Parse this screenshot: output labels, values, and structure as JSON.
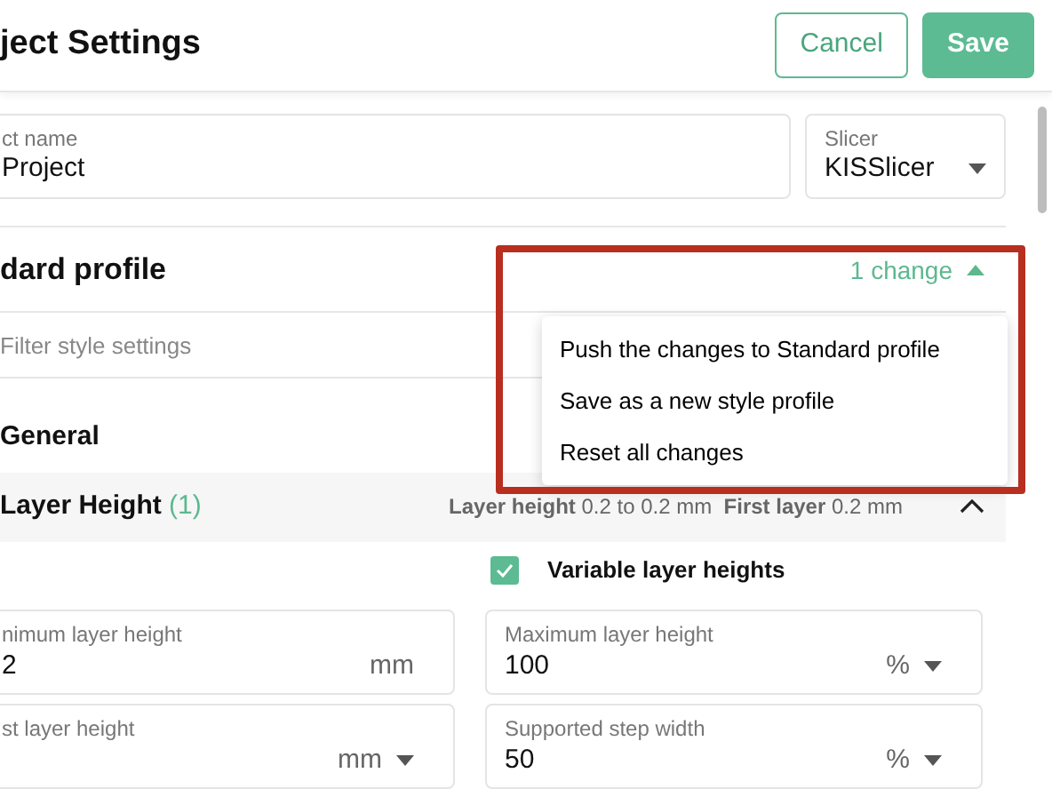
{
  "header": {
    "title": "ject Settings",
    "buttons": [
      {
        "label": "Cancel",
        "kind": "outline"
      },
      {
        "label": "Save",
        "kind": "primary"
      }
    ]
  },
  "project_fields": [
    {
      "label": "ct name",
      "value": "Project",
      "kind": "text"
    },
    {
      "label": "Slicer",
      "value": "KISSlicer",
      "kind": "select"
    }
  ],
  "profile": {
    "name": "dard profile",
    "changes": "1 change",
    "expanded": true,
    "menu": [
      "Push the changes to Standard profile",
      "Save as a new style profile",
      "Reset all changes"
    ]
  },
  "filter": {
    "placeholder": "Filter style settings"
  },
  "section": {
    "title": "General"
  },
  "group": {
    "title": "Layer Height",
    "count": "(1)",
    "expanded": true,
    "summary": [
      {
        "label": "Layer height",
        "value": "0.2 to 0.2 mm"
      },
      {
        "label": "First layer",
        "value": "0.2 mm"
      }
    ]
  },
  "variable": {
    "label": "Variable layer heights",
    "checked": true
  },
  "fields": [
    {
      "label": "nimum layer height",
      "value": "2",
      "unit": "mm",
      "has_menu": false
    },
    {
      "label": "Maximum layer height",
      "value": "100",
      "unit": "%",
      "has_menu": true
    },
    {
      "label": "st layer height",
      "unit": "mm",
      "has_menu": true
    },
    {
      "label": "Supported step width",
      "value": "50",
      "unit": "%",
      "has_menu": true
    }
  ]
}
